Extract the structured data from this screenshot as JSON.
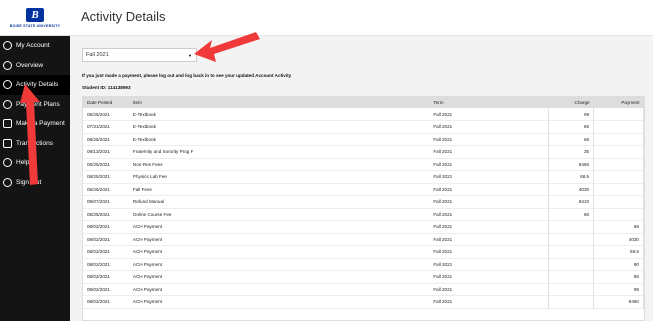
{
  "logo": {
    "letter": "B",
    "text": "BOISE STATE UNIVERSITY"
  },
  "sidebar": {
    "items": [
      {
        "label": "My Account",
        "icon": "user-icon",
        "active": false
      },
      {
        "label": "Overview",
        "icon": "dashboard-icon",
        "active": false
      },
      {
        "label": "Activity Details",
        "icon": "clock-icon",
        "active": true
      },
      {
        "label": "Payment Plans",
        "icon": "gear-icon",
        "active": false
      },
      {
        "label": "Make a Payment",
        "icon": "card-icon",
        "active": false
      },
      {
        "label": "Transactions",
        "icon": "list-icon",
        "active": false
      },
      {
        "label": "Help",
        "icon": "help-icon",
        "active": false
      },
      {
        "label": "Sign Out",
        "icon": "sign-out-icon",
        "active": false
      }
    ]
  },
  "header": {
    "title": "Activity Details"
  },
  "term_select": {
    "value": "Fall 2021"
  },
  "notice": "If you just made a payment, please log out and log back in to see your updated Account Activity",
  "student_id": "Student ID: 114138993",
  "table": {
    "columns": [
      "Date Posted",
      "Item",
      "Term",
      "Charge",
      "Payment"
    ],
    "rows": [
      [
        "05/25/2021",
        "E-Textbook",
        "Fall 2021",
        "99",
        ""
      ],
      [
        "07/31/2021",
        "E-Textbook",
        "Fall 2021",
        "86",
        ""
      ],
      [
        "08/25/2021",
        "E-Textbook",
        "Fall 2021",
        "66",
        ""
      ],
      [
        "08/13/2021",
        "Fraternity and Sorority Prog F",
        "Fall 2021",
        "35",
        ""
      ],
      [
        "05/25/2021",
        "Non-Res Fees",
        "Fall 2021",
        "8460",
        ""
      ],
      [
        "08/25/2021",
        "Physics Lab Fee",
        "Fall 2021",
        "68.5",
        ""
      ],
      [
        "05/25/2021",
        "Fall Fees",
        "Fall 2021",
        "4030",
        ""
      ],
      [
        "09/07/2021",
        "Refund Manual",
        "Fall 2021",
        "8410",
        ""
      ],
      [
        "05/25/2021",
        "Online Course Fee",
        "Fall 2021",
        "60",
        ""
      ],
      [
        "08/02/2021",
        "ACH Payment",
        "Fall 2021",
        "",
        "66"
      ],
      [
        "08/02/2021",
        "ACH Payment",
        "Fall 2021",
        "",
        "4030"
      ],
      [
        "08/02/2021",
        "ACH Payment",
        "Fall 2021",
        "",
        "68.5"
      ],
      [
        "08/02/2021",
        "ACH Payment",
        "Fall 2021",
        "",
        "90"
      ],
      [
        "08/02/2021",
        "ACH Payment",
        "Fall 2021",
        "",
        "86"
      ],
      [
        "08/02/2021",
        "ACH Payment",
        "Fall 2021",
        "",
        "99"
      ],
      [
        "08/02/2021",
        "ACH Payment",
        "Fall 2021",
        "",
        "8460"
      ]
    ]
  },
  "colors": {
    "sidebar": "#141414",
    "arrow": "#f03a3a",
    "accent": "#0033a0"
  }
}
